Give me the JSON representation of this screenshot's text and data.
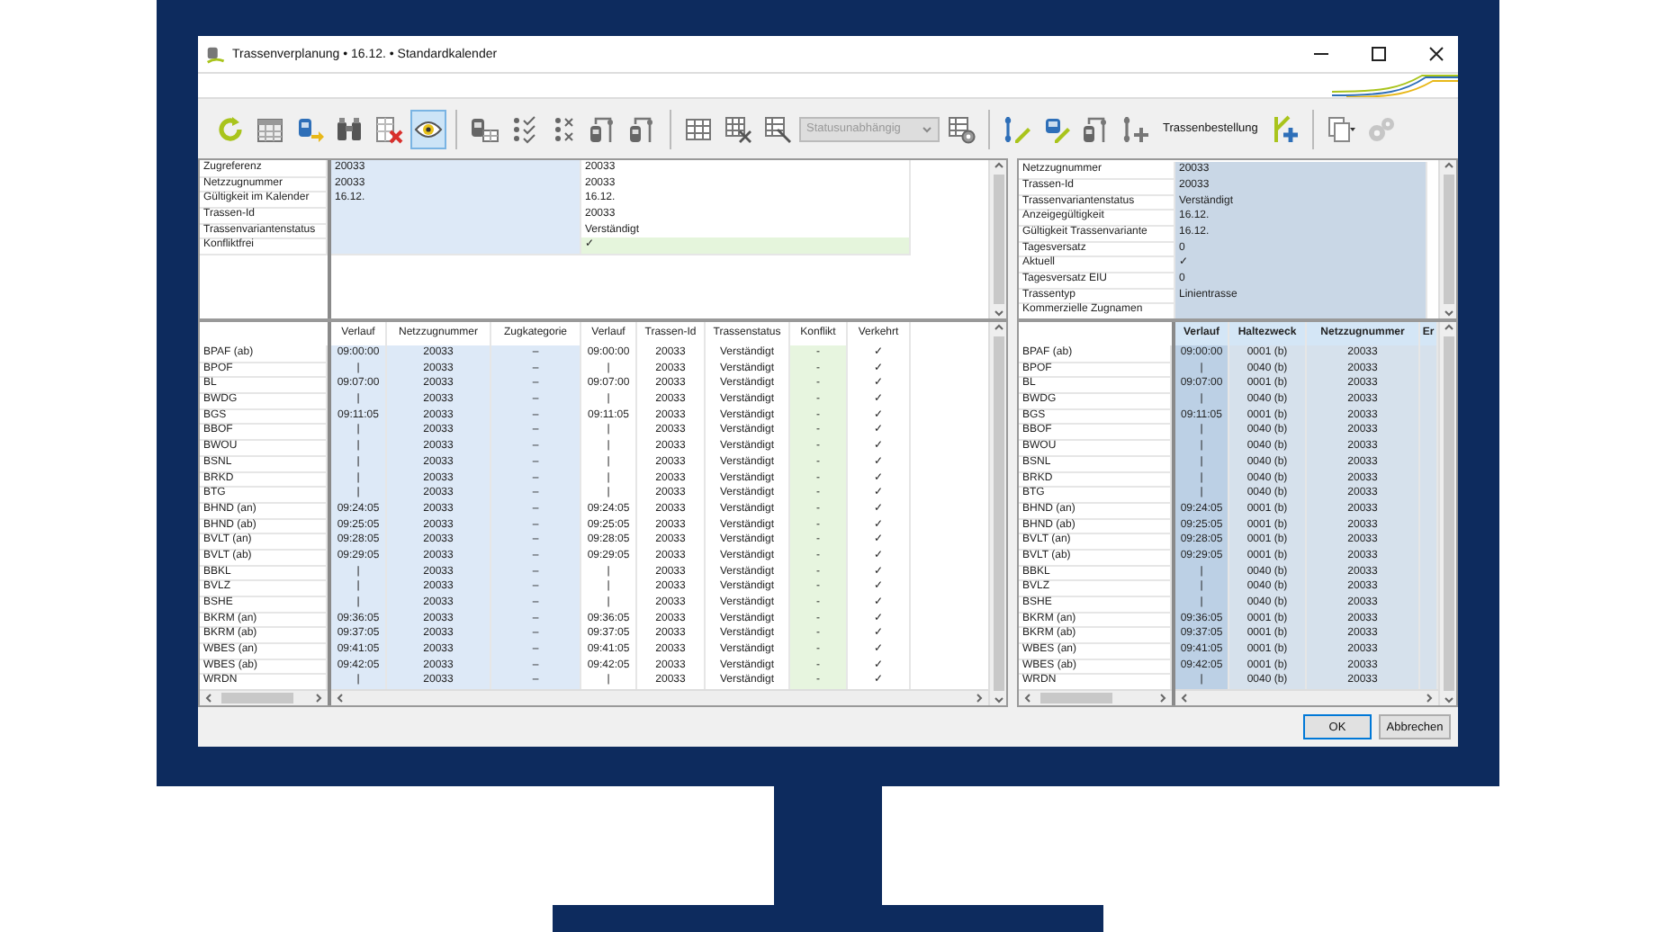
{
  "window": {
    "title": "Trassenverplanung • 16.12. • Standardkalender"
  },
  "toolbar": [
    {
      "kind": "refresh",
      "selected": false,
      "disabled": false
    },
    {
      "kind": "calendar",
      "selected": false,
      "disabled": false
    },
    {
      "kind": "train_arrow",
      "selected": false,
      "disabled": false
    },
    {
      "kind": "binoculars",
      "selected": false,
      "disabled": false
    },
    {
      "kind": "table_delete",
      "selected": false,
      "disabled": false
    },
    {
      "kind": "eye",
      "selected": true,
      "disabled": false
    },
    {
      "kind": "separator"
    },
    {
      "kind": "train_table",
      "selected": false,
      "disabled": false
    },
    {
      "kind": "list_check",
      "selected": false,
      "disabled": false
    },
    {
      "kind": "list_delete",
      "selected": false,
      "disabled": false
    },
    {
      "kind": "train_link",
      "selected": false,
      "disabled": false
    },
    {
      "kind": "train_link",
      "selected": false,
      "disabled": false
    },
    {
      "kind": "separator"
    },
    {
      "kind": "grid",
      "selected": false,
      "disabled": false
    },
    {
      "kind": "grid_delete",
      "selected": false,
      "disabled": false
    },
    {
      "kind": "grid_cursor",
      "selected": false,
      "disabled": false
    },
    {
      "kind": "dropdown",
      "value": "Statusunabhängig",
      "disabled": true
    },
    {
      "kind": "grid_settings",
      "selected": false,
      "disabled": false
    },
    {
      "kind": "separator"
    },
    {
      "kind": "route_edit",
      "selected": false,
      "disabled": false
    },
    {
      "kind": "train_edit",
      "selected": false,
      "disabled": false
    },
    {
      "kind": "train_link",
      "selected": false,
      "disabled": false
    },
    {
      "kind": "route_add",
      "selected": false,
      "disabled": false
    },
    {
      "kind": "text",
      "label": "Trassenbestellung",
      "selected": false,
      "disabled": false
    },
    {
      "kind": "branch_add",
      "selected": false,
      "disabled": false
    },
    {
      "kind": "separator"
    },
    {
      "kind": "copy",
      "selected": false,
      "disabled": false
    },
    {
      "kind": "settings",
      "selected": false,
      "disabled": true
    }
  ],
  "header_grid": {
    "rows": [
      {
        "label": "Zugreferenz",
        "value_1": "20033",
        "value_2": "20033",
        "highlighted": false
      },
      {
        "label": "Netzzugnummer",
        "value_1": "20033",
        "value_2": "20033",
        "highlighted": false
      },
      {
        "label": "Gültigkeit im Kalender",
        "value_1": "16.12.",
        "value_2": "16.12.",
        "highlighted": false
      },
      {
        "label": "Trassen-Id",
        "value_2": "20033",
        "highlighted": false
      },
      {
        "label": "Trassenvariantenstatus",
        "value_2": "Verständigt",
        "highlighted": false
      },
      {
        "label": "Konfliktfrei",
        "value_2": "✓",
        "highlighted": true
      }
    ]
  },
  "details_grid": {
    "rows": [
      {
        "label": "Netzzugnummer",
        "value": "20033"
      },
      {
        "label": "Trassen-Id",
        "value": "20033"
      },
      {
        "label": "Trassenvariantenstatus",
        "value": "Verständigt"
      },
      {
        "label": "Anzeigegültigkeit",
        "value": "16.12."
      },
      {
        "label": "Gültigkeit Trassenvariante",
        "value": "16.12."
      },
      {
        "label": "Tagesversatz",
        "value": "0"
      },
      {
        "label": "Aktuell",
        "value": "✓"
      },
      {
        "label": "Tagesversatz EIU",
        "value": "0"
      },
      {
        "label": "Trassentyp",
        "value": "Linientrasse"
      },
      {
        "label": "Kommerzielle Zugnamen"
      }
    ]
  },
  "route_table": {
    "columns": [
      {
        "label": "Verlauf",
        "color": "#dde9f7"
      },
      {
        "label": "Netzzugnummer",
        "color": "#dde9f7"
      },
      {
        "label": "Zugkategorie",
        "color": "#dde9f7"
      },
      {
        "label": "Verlauf",
        "color": "#ffffff"
      },
      {
        "label": "Trassen-Id",
        "color": "#ffffff"
      },
      {
        "label": "Trassenstatus",
        "color": "#ffffff"
      },
      {
        "label": "Konflikt",
        "color": "#e7f5df"
      },
      {
        "label": "Verkehrt",
        "color": "#ffffff"
      }
    ],
    "rows": [
      {
        "station": "BPAF (ab)",
        "cells": [
          "09:00:00",
          "20033",
          "–",
          "09:00:00",
          "20033",
          "Verständigt",
          "-",
          "✓"
        ]
      },
      {
        "station": "BPOF",
        "cells": [
          "|",
          "20033",
          "–",
          "|",
          "20033",
          "Verständigt",
          "-",
          "✓"
        ]
      },
      {
        "station": "BL",
        "cells": [
          "09:07:00",
          "20033",
          "–",
          "09:07:00",
          "20033",
          "Verständigt",
          "-",
          "✓"
        ]
      },
      {
        "station": "BWDG",
        "cells": [
          "|",
          "20033",
          "–",
          "|",
          "20033",
          "Verständigt",
          "-",
          "✓"
        ]
      },
      {
        "station": "BGS",
        "cells": [
          "09:11:05",
          "20033",
          "–",
          "09:11:05",
          "20033",
          "Verständigt",
          "-",
          "✓"
        ]
      },
      {
        "station": "BBOF",
        "cells": [
          "|",
          "20033",
          "–",
          "|",
          "20033",
          "Verständigt",
          "-",
          "✓"
        ]
      },
      {
        "station": "BWOU",
        "cells": [
          "|",
          "20033",
          "–",
          "|",
          "20033",
          "Verständigt",
          "-",
          "✓"
        ]
      },
      {
        "station": "BSNL",
        "cells": [
          "|",
          "20033",
          "–",
          "|",
          "20033",
          "Verständigt",
          "-",
          "✓"
        ]
      },
      {
        "station": "BRKD",
        "cells": [
          "|",
          "20033",
          "–",
          "|",
          "20033",
          "Verständigt",
          "-",
          "✓"
        ]
      },
      {
        "station": "BTG",
        "cells": [
          "|",
          "20033",
          "–",
          "|",
          "20033",
          "Verständigt",
          "-",
          "✓"
        ]
      },
      {
        "station": "BHND (an)",
        "cells": [
          "09:24:05",
          "20033",
          "–",
          "09:24:05",
          "20033",
          "Verständigt",
          "-",
          "✓"
        ]
      },
      {
        "station": "BHND (ab)",
        "cells": [
          "09:25:05",
          "20033",
          "–",
          "09:25:05",
          "20033",
          "Verständigt",
          "-",
          "✓"
        ]
      },
      {
        "station": "BVLT (an)",
        "cells": [
          "09:28:05",
          "20033",
          "–",
          "09:28:05",
          "20033",
          "Verständigt",
          "-",
          "✓"
        ]
      },
      {
        "station": "BVLT (ab)",
        "cells": [
          "09:29:05",
          "20033",
          "–",
          "09:29:05",
          "20033",
          "Verständigt",
          "-",
          "✓"
        ]
      },
      {
        "station": "BBKL",
        "cells": [
          "|",
          "20033",
          "–",
          "|",
          "20033",
          "Verständigt",
          "-",
          "✓"
        ]
      },
      {
        "station": "BVLZ",
        "cells": [
          "|",
          "20033",
          "–",
          "|",
          "20033",
          "Verständigt",
          "-",
          "✓"
        ]
      },
      {
        "station": "BSHE",
        "cells": [
          "|",
          "20033",
          "–",
          "|",
          "20033",
          "Verständigt",
          "-",
          "✓"
        ]
      },
      {
        "station": "BKRM (an)",
        "cells": [
          "09:36:05",
          "20033",
          "–",
          "09:36:05",
          "20033",
          "Verständigt",
          "-",
          "✓"
        ]
      },
      {
        "station": "BKRM (ab)",
        "cells": [
          "09:37:05",
          "20033",
          "–",
          "09:37:05",
          "20033",
          "Verständigt",
          "-",
          "✓"
        ]
      },
      {
        "station": "WBES (an)",
        "cells": [
          "09:41:05",
          "20033",
          "–",
          "09:41:05",
          "20033",
          "Verständigt",
          "-",
          "✓"
        ]
      },
      {
        "station": "WBES (ab)",
        "cells": [
          "09:42:05",
          "20033",
          "–",
          "09:42:05",
          "20033",
          "Verständigt",
          "-",
          "✓"
        ]
      },
      {
        "station": "WRDN",
        "cells": [
          "|",
          "20033",
          "–",
          "|",
          "20033",
          "Verständigt",
          "-",
          "✓"
        ]
      }
    ]
  },
  "stop_table": {
    "columns": [
      {
        "label": "Verlauf",
        "color": "#bcd0e5"
      },
      {
        "label": "Haltezweck",
        "color": "#d6e1ec"
      },
      {
        "label": "Netzzugnummer",
        "color": "#d6e1ec"
      },
      {
        "label": "Er",
        "color": "#d6e1ec"
      }
    ],
    "rows": [
      {
        "station": "BPAF (ab)",
        "cells": [
          "09:00:00",
          "0001 (b)",
          "20033"
        ]
      },
      {
        "station": "BPOF",
        "cells": [
          "|",
          "0040 (b)",
          "20033"
        ]
      },
      {
        "station": "BL",
        "cells": [
          "09:07:00",
          "0001 (b)",
          "20033"
        ]
      },
      {
        "station": "BWDG",
        "cells": [
          "|",
          "0040 (b)",
          "20033"
        ]
      },
      {
        "station": "BGS",
        "cells": [
          "09:11:05",
          "0001 (b)",
          "20033"
        ]
      },
      {
        "station": "BBOF",
        "cells": [
          "|",
          "0040 (b)",
          "20033"
        ]
      },
      {
        "station": "BWOU",
        "cells": [
          "|",
          "0040 (b)",
          "20033"
        ]
      },
      {
        "station": "BSNL",
        "cells": [
          "|",
          "0040 (b)",
          "20033"
        ]
      },
      {
        "station": "BRKD",
        "cells": [
          "|",
          "0040 (b)",
          "20033"
        ]
      },
      {
        "station": "BTG",
        "cells": [
          "|",
          "0040 (b)",
          "20033"
        ]
      },
      {
        "station": "BHND (an)",
        "cells": [
          "09:24:05",
          "0001 (b)",
          "20033"
        ]
      },
      {
        "station": "BHND (ab)",
        "cells": [
          "09:25:05",
          "0001 (b)",
          "20033"
        ]
      },
      {
        "station": "BVLT (an)",
        "cells": [
          "09:28:05",
          "0001 (b)",
          "20033"
        ]
      },
      {
        "station": "BVLT (ab)",
        "cells": [
          "09:29:05",
          "0001 (b)",
          "20033"
        ]
      },
      {
        "station": "BBKL",
        "cells": [
          "|",
          "0040 (b)",
          "20033"
        ]
      },
      {
        "station": "BVLZ",
        "cells": [
          "|",
          "0040 (b)",
          "20033"
        ]
      },
      {
        "station": "BSHE",
        "cells": [
          "|",
          "0040 (b)",
          "20033"
        ]
      },
      {
        "station": "BKRM (an)",
        "cells": [
          "09:36:05",
          "0001 (b)",
          "20033"
        ]
      },
      {
        "station": "BKRM (ab)",
        "cells": [
          "09:37:05",
          "0001 (b)",
          "20033"
        ]
      },
      {
        "station": "WBES (an)",
        "cells": [
          "09:41:05",
          "0001 (b)",
          "20033"
        ]
      },
      {
        "station": "WBES (ab)",
        "cells": [
          "09:42:05",
          "0001 (b)",
          "20033"
        ]
      },
      {
        "station": "WRDN",
        "cells": [
          "|",
          "0040 (b)",
          "20033"
        ]
      }
    ]
  },
  "buttons": [
    {
      "label": "OK",
      "default": true
    },
    {
      "label": "Abbrechen",
      "default": false
    }
  ]
}
